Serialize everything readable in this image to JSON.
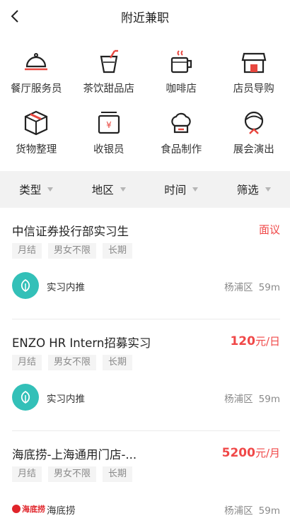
{
  "header": {
    "title": "附近兼职"
  },
  "categories": [
    {
      "label": "餐厅服务员",
      "icon": "cloche-icon"
    },
    {
      "label": "茶饮甜品店",
      "icon": "drink-cup-icon"
    },
    {
      "label": "咖啡店",
      "icon": "coffee-cup-icon"
    },
    {
      "label": "店员导购",
      "icon": "storefront-icon"
    },
    {
      "label": "货物整理",
      "icon": "package-box-icon"
    },
    {
      "label": "收银员",
      "icon": "cash-register-icon"
    },
    {
      "label": "食品制作",
      "icon": "chef-hat-icon"
    },
    {
      "label": "展会演出",
      "icon": "performer-icon"
    }
  ],
  "filters": [
    {
      "label": "类型"
    },
    {
      "label": "地区"
    },
    {
      "label": "时间"
    },
    {
      "label": "筛选"
    }
  ],
  "jobs": [
    {
      "title": "中信证券投行部实习生",
      "salary_text": "面议",
      "salary_num": "",
      "salary_unit": "",
      "tags": [
        "月结",
        "男女不限",
        "长期"
      ],
      "company": "实习内推",
      "district": "杨浦区",
      "distance": "59m"
    },
    {
      "title": "ENZO HR Intern招募实习",
      "salary_text": "",
      "salary_num": "120",
      "salary_unit": "元/日",
      "tags": [
        "月结",
        "男女不限",
        "长期"
      ],
      "company": "实习内推",
      "district": "杨浦区",
      "distance": "59m"
    },
    {
      "title": "海底捞-上海通用门店-...",
      "salary_text": "",
      "salary_num": "5200",
      "salary_unit": "元/月",
      "tags": [
        "月结",
        "男女不限",
        "长期"
      ],
      "company": "海底捞",
      "company_logo_text": "海底捞",
      "district": "杨浦区",
      "distance": "59m"
    }
  ],
  "colors": {
    "accent": "#f04848",
    "icon_red": "#e8473f",
    "logo_teal": "#33c0b8",
    "filter_bg": "#f2f2f2"
  }
}
